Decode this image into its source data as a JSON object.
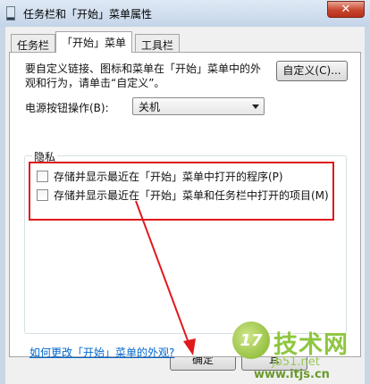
{
  "window": {
    "title": "任务栏和「开始」菜单属性",
    "close_label": "✕"
  },
  "tabs": [
    {
      "label": "任务栏",
      "active": false
    },
    {
      "label": "「开始」菜单",
      "active": true
    },
    {
      "label": "工具栏",
      "active": false
    }
  ],
  "start_menu_tab": {
    "description": "要自定义链接、图标和菜单在「开始」菜单中的外观和行为，请单击“自定义”。",
    "customize_button": "自定义(C)...",
    "power_label": "电源按钮操作(B):",
    "power_value": "关机",
    "privacy": {
      "title": "隐私",
      "option1": "存储并显示最近在「开始」菜单中打开的程序(P)",
      "option1_checked": false,
      "option2": "存储并显示最近在「开始」菜单和任务栏中打开的项目(M)",
      "option2_checked": false
    },
    "help_link": "如何更改「开始」菜单的外观?"
  },
  "buttons": {
    "ok": "确定",
    "cancel_partial": "耳"
  },
  "watermark": {
    "logo_text": "17",
    "name": "技术网",
    "sub": "jb51.net",
    "site": "www.itjs.cn"
  },
  "colors": {
    "highlight": "#e0191b",
    "arrow": "#e0191b",
    "link": "#0066cc"
  }
}
